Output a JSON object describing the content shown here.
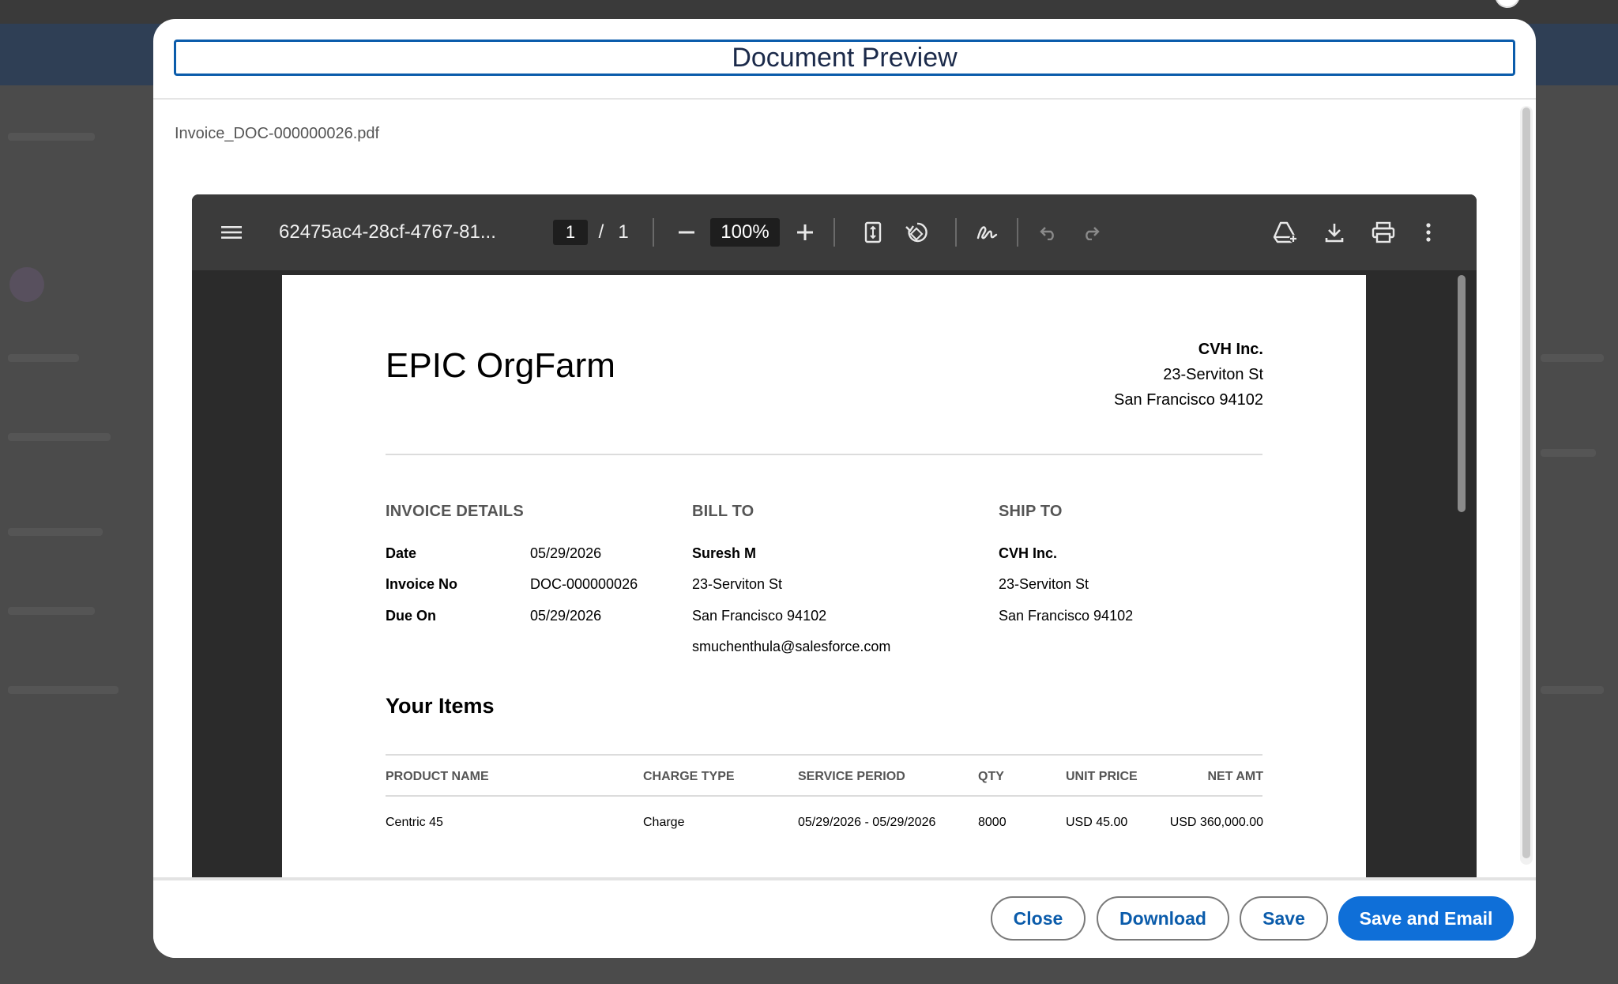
{
  "modal": {
    "title": "Document Preview",
    "filename": "Invoice_DOC-000000026.pdf"
  },
  "viewer": {
    "doc_title": "62475ac4-28cf-4767-81...",
    "current_page": "1",
    "page_sep": "/",
    "total_pages": "1",
    "zoom": "100%",
    "icons": {
      "menu": "menu-icon",
      "zoom_out": "minus-icon",
      "zoom_in": "plus-icon",
      "fit": "fit-page-icon",
      "rotate": "rotate-icon",
      "annotate": "draw-icon",
      "undo": "undo-icon",
      "redo": "redo-icon",
      "drive": "drive-add-icon",
      "download": "download-icon",
      "print": "print-icon",
      "more": "more-vert-icon"
    }
  },
  "invoice": {
    "company": "EPIC OrgFarm",
    "seller": {
      "name": "CVH Inc.",
      "street": "23-Serviton St",
      "city": "San Francisco 94102"
    },
    "details": {
      "heading": "INVOICE DETAILS",
      "date_label": "Date",
      "date_value": "05/29/2026",
      "invoice_no_label": "Invoice No",
      "invoice_no_value": "DOC-000000026",
      "due_label": "Due On",
      "due_value": "05/29/2026"
    },
    "bill_to": {
      "heading": "BILL TO",
      "name": "Suresh M",
      "street": "23-Serviton St",
      "city": "San Francisco 94102",
      "email": "smuchenthula@salesforce.com"
    },
    "ship_to": {
      "heading": "SHIP TO",
      "name": "CVH Inc.",
      "street": "23-Serviton St",
      "city": "San Francisco 94102"
    },
    "items_heading": "Your Items",
    "columns": {
      "product": "PRODUCT NAME",
      "charge_type": "CHARGE TYPE",
      "period": "SERVICE PERIOD",
      "qty": "QTY",
      "unit_price": "UNIT PRICE",
      "net_amt": "NET AMT"
    },
    "rows": [
      {
        "product": "Centric 45",
        "charge_type": "Charge",
        "period": "05/29/2026 - 05/29/2026",
        "qty": "8000",
        "unit_price": "USD 45.00",
        "net_amt": "USD 360,000.00"
      }
    ]
  },
  "footer": {
    "close": "Close",
    "download": "Download",
    "save": "Save",
    "save_email": "Save and Email"
  },
  "colors": {
    "brand": "#0f6fd8",
    "title_border": "#0b5cab",
    "toolbar": "#3b3b3b"
  }
}
